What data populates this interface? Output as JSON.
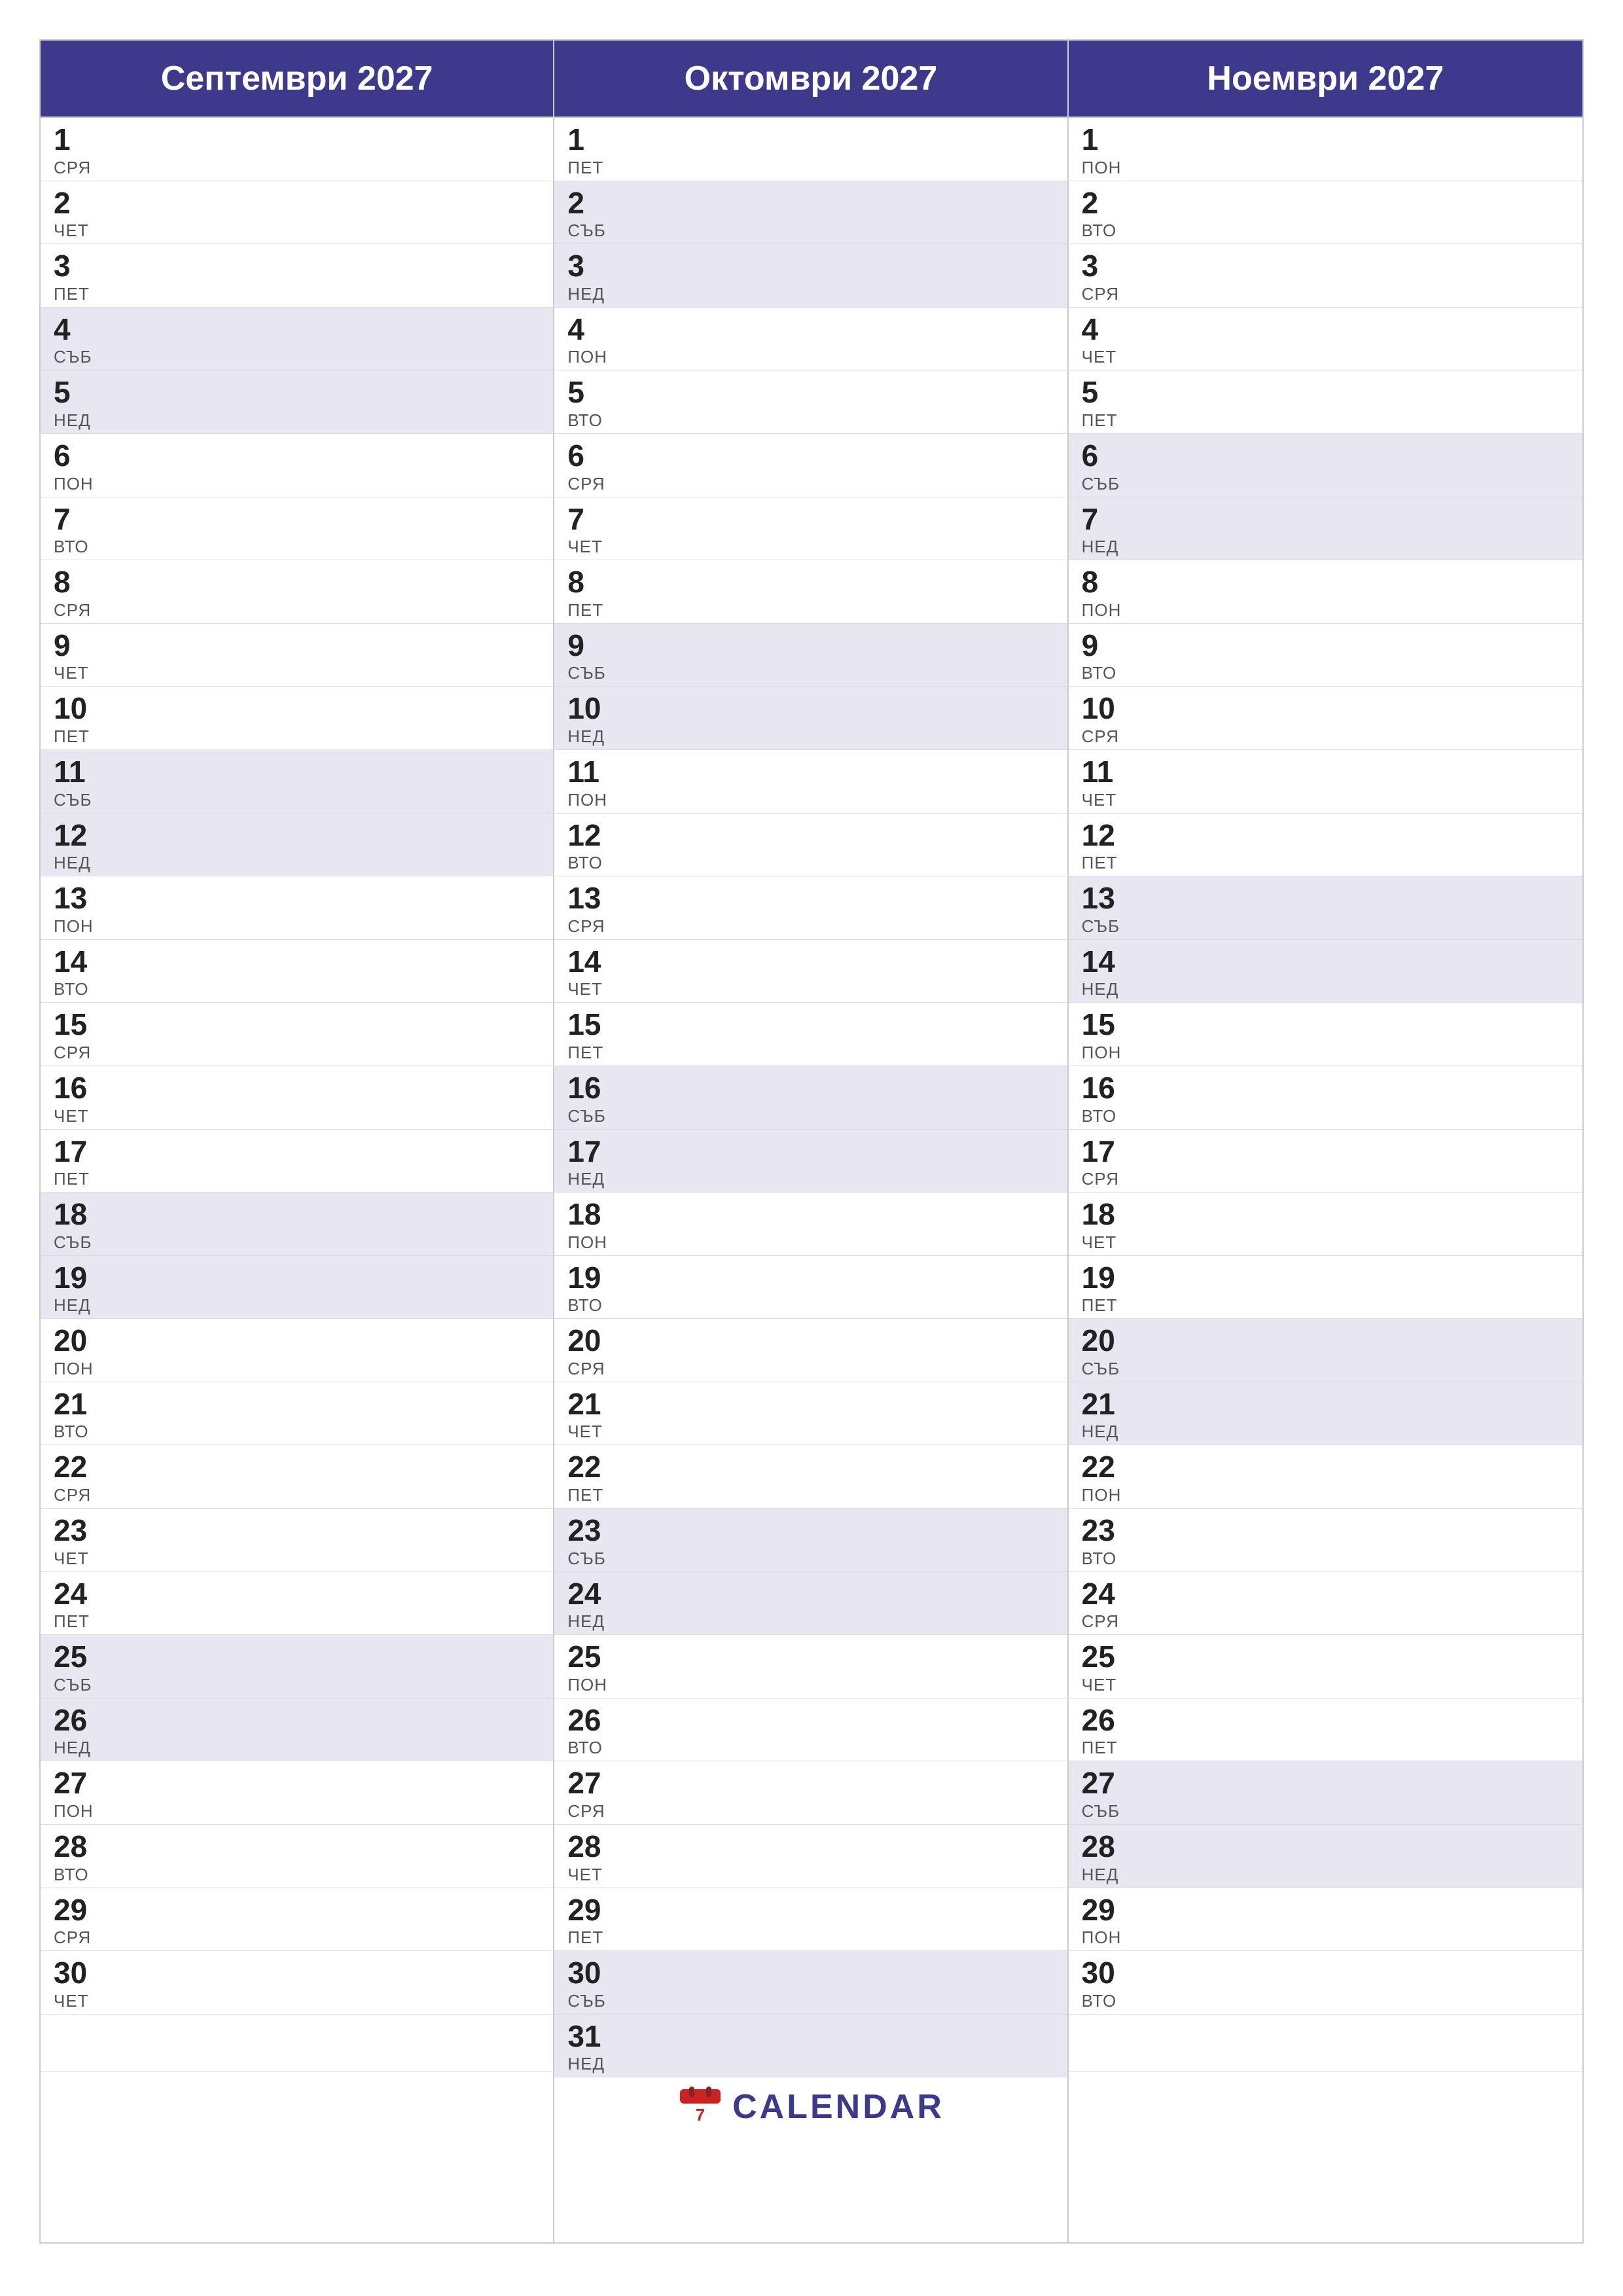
{
  "months": [
    {
      "name": "Септември 2027",
      "id": "september",
      "days": [
        {
          "num": "1",
          "name": "СРЯ",
          "weekend": false
        },
        {
          "num": "2",
          "name": "ЧЕТ",
          "weekend": false
        },
        {
          "num": "3",
          "name": "ПЕТ",
          "weekend": false
        },
        {
          "num": "4",
          "name": "СЪБ",
          "weekend": true
        },
        {
          "num": "5",
          "name": "НЕД",
          "weekend": true
        },
        {
          "num": "6",
          "name": "ПОН",
          "weekend": false
        },
        {
          "num": "7",
          "name": "ВТО",
          "weekend": false
        },
        {
          "num": "8",
          "name": "СРЯ",
          "weekend": false
        },
        {
          "num": "9",
          "name": "ЧЕТ",
          "weekend": false
        },
        {
          "num": "10",
          "name": "ПЕТ",
          "weekend": false
        },
        {
          "num": "11",
          "name": "СЪБ",
          "weekend": true
        },
        {
          "num": "12",
          "name": "НЕД",
          "weekend": true
        },
        {
          "num": "13",
          "name": "ПОН",
          "weekend": false
        },
        {
          "num": "14",
          "name": "ВТО",
          "weekend": false
        },
        {
          "num": "15",
          "name": "СРЯ",
          "weekend": false
        },
        {
          "num": "16",
          "name": "ЧЕТ",
          "weekend": false
        },
        {
          "num": "17",
          "name": "ПЕТ",
          "weekend": false
        },
        {
          "num": "18",
          "name": "СЪБ",
          "weekend": true
        },
        {
          "num": "19",
          "name": "НЕД",
          "weekend": true
        },
        {
          "num": "20",
          "name": "ПОН",
          "weekend": false
        },
        {
          "num": "21",
          "name": "ВТО",
          "weekend": false
        },
        {
          "num": "22",
          "name": "СРЯ",
          "weekend": false
        },
        {
          "num": "23",
          "name": "ЧЕТ",
          "weekend": false
        },
        {
          "num": "24",
          "name": "ПЕТ",
          "weekend": false
        },
        {
          "num": "25",
          "name": "СЪБ",
          "weekend": true
        },
        {
          "num": "26",
          "name": "НЕД",
          "weekend": true
        },
        {
          "num": "27",
          "name": "ПОН",
          "weekend": false
        },
        {
          "num": "28",
          "name": "ВТО",
          "weekend": false
        },
        {
          "num": "29",
          "name": "СРЯ",
          "weekend": false
        },
        {
          "num": "30",
          "name": "ЧЕТ",
          "weekend": false
        }
      ]
    },
    {
      "name": "Октомври 2027",
      "id": "october",
      "days": [
        {
          "num": "1",
          "name": "ПЕТ",
          "weekend": false
        },
        {
          "num": "2",
          "name": "СЪБ",
          "weekend": true
        },
        {
          "num": "3",
          "name": "НЕД",
          "weekend": true
        },
        {
          "num": "4",
          "name": "ПОН",
          "weekend": false
        },
        {
          "num": "5",
          "name": "ВТО",
          "weekend": false
        },
        {
          "num": "6",
          "name": "СРЯ",
          "weekend": false
        },
        {
          "num": "7",
          "name": "ЧЕТ",
          "weekend": false
        },
        {
          "num": "8",
          "name": "ПЕТ",
          "weekend": false
        },
        {
          "num": "9",
          "name": "СЪБ",
          "weekend": true
        },
        {
          "num": "10",
          "name": "НЕД",
          "weekend": true
        },
        {
          "num": "11",
          "name": "ПОН",
          "weekend": false
        },
        {
          "num": "12",
          "name": "ВТО",
          "weekend": false
        },
        {
          "num": "13",
          "name": "СРЯ",
          "weekend": false
        },
        {
          "num": "14",
          "name": "ЧЕТ",
          "weekend": false
        },
        {
          "num": "15",
          "name": "ПЕТ",
          "weekend": false
        },
        {
          "num": "16",
          "name": "СЪБ",
          "weekend": true
        },
        {
          "num": "17",
          "name": "НЕД",
          "weekend": true
        },
        {
          "num": "18",
          "name": "ПОН",
          "weekend": false
        },
        {
          "num": "19",
          "name": "ВТО",
          "weekend": false
        },
        {
          "num": "20",
          "name": "СРЯ",
          "weekend": false
        },
        {
          "num": "21",
          "name": "ЧЕТ",
          "weekend": false
        },
        {
          "num": "22",
          "name": "ПЕТ",
          "weekend": false
        },
        {
          "num": "23",
          "name": "СЪБ",
          "weekend": true
        },
        {
          "num": "24",
          "name": "НЕД",
          "weekend": true
        },
        {
          "num": "25",
          "name": "ПОН",
          "weekend": false
        },
        {
          "num": "26",
          "name": "ВТО",
          "weekend": false
        },
        {
          "num": "27",
          "name": "СРЯ",
          "weekend": false
        },
        {
          "num": "28",
          "name": "ЧЕТ",
          "weekend": false
        },
        {
          "num": "29",
          "name": "ПЕТ",
          "weekend": false
        },
        {
          "num": "30",
          "name": "СЪБ",
          "weekend": true
        },
        {
          "num": "31",
          "name": "НЕД",
          "weekend": true
        }
      ]
    },
    {
      "name": "Ноември 2027",
      "id": "november",
      "days": [
        {
          "num": "1",
          "name": "ПОН",
          "weekend": false
        },
        {
          "num": "2",
          "name": "ВТО",
          "weekend": false
        },
        {
          "num": "3",
          "name": "СРЯ",
          "weekend": false
        },
        {
          "num": "4",
          "name": "ЧЕТ",
          "weekend": false
        },
        {
          "num": "5",
          "name": "ПЕТ",
          "weekend": false
        },
        {
          "num": "6",
          "name": "СЪБ",
          "weekend": true
        },
        {
          "num": "7",
          "name": "НЕД",
          "weekend": true
        },
        {
          "num": "8",
          "name": "ПОН",
          "weekend": false
        },
        {
          "num": "9",
          "name": "ВТО",
          "weekend": false
        },
        {
          "num": "10",
          "name": "СРЯ",
          "weekend": false
        },
        {
          "num": "11",
          "name": "ЧЕТ",
          "weekend": false
        },
        {
          "num": "12",
          "name": "ПЕТ",
          "weekend": false
        },
        {
          "num": "13",
          "name": "СЪБ",
          "weekend": true
        },
        {
          "num": "14",
          "name": "НЕД",
          "weekend": true
        },
        {
          "num": "15",
          "name": "ПОН",
          "weekend": false
        },
        {
          "num": "16",
          "name": "ВТО",
          "weekend": false
        },
        {
          "num": "17",
          "name": "СРЯ",
          "weekend": false
        },
        {
          "num": "18",
          "name": "ЧЕТ",
          "weekend": false
        },
        {
          "num": "19",
          "name": "ПЕТ",
          "weekend": false
        },
        {
          "num": "20",
          "name": "СЪБ",
          "weekend": true
        },
        {
          "num": "21",
          "name": "НЕД",
          "weekend": true
        },
        {
          "num": "22",
          "name": "ПОН",
          "weekend": false
        },
        {
          "num": "23",
          "name": "ВТО",
          "weekend": false
        },
        {
          "num": "24",
          "name": "СРЯ",
          "weekend": false
        },
        {
          "num": "25",
          "name": "ЧЕТ",
          "weekend": false
        },
        {
          "num": "26",
          "name": "ПЕТ",
          "weekend": false
        },
        {
          "num": "27",
          "name": "СЪБ",
          "weekend": true
        },
        {
          "num": "28",
          "name": "НЕД",
          "weekend": true
        },
        {
          "num": "29",
          "name": "ПОН",
          "weekend": false
        },
        {
          "num": "30",
          "name": "ВТО",
          "weekend": false
        }
      ]
    }
  ],
  "logo": {
    "text": "CALENDAR",
    "color": "#3d3a8c"
  }
}
